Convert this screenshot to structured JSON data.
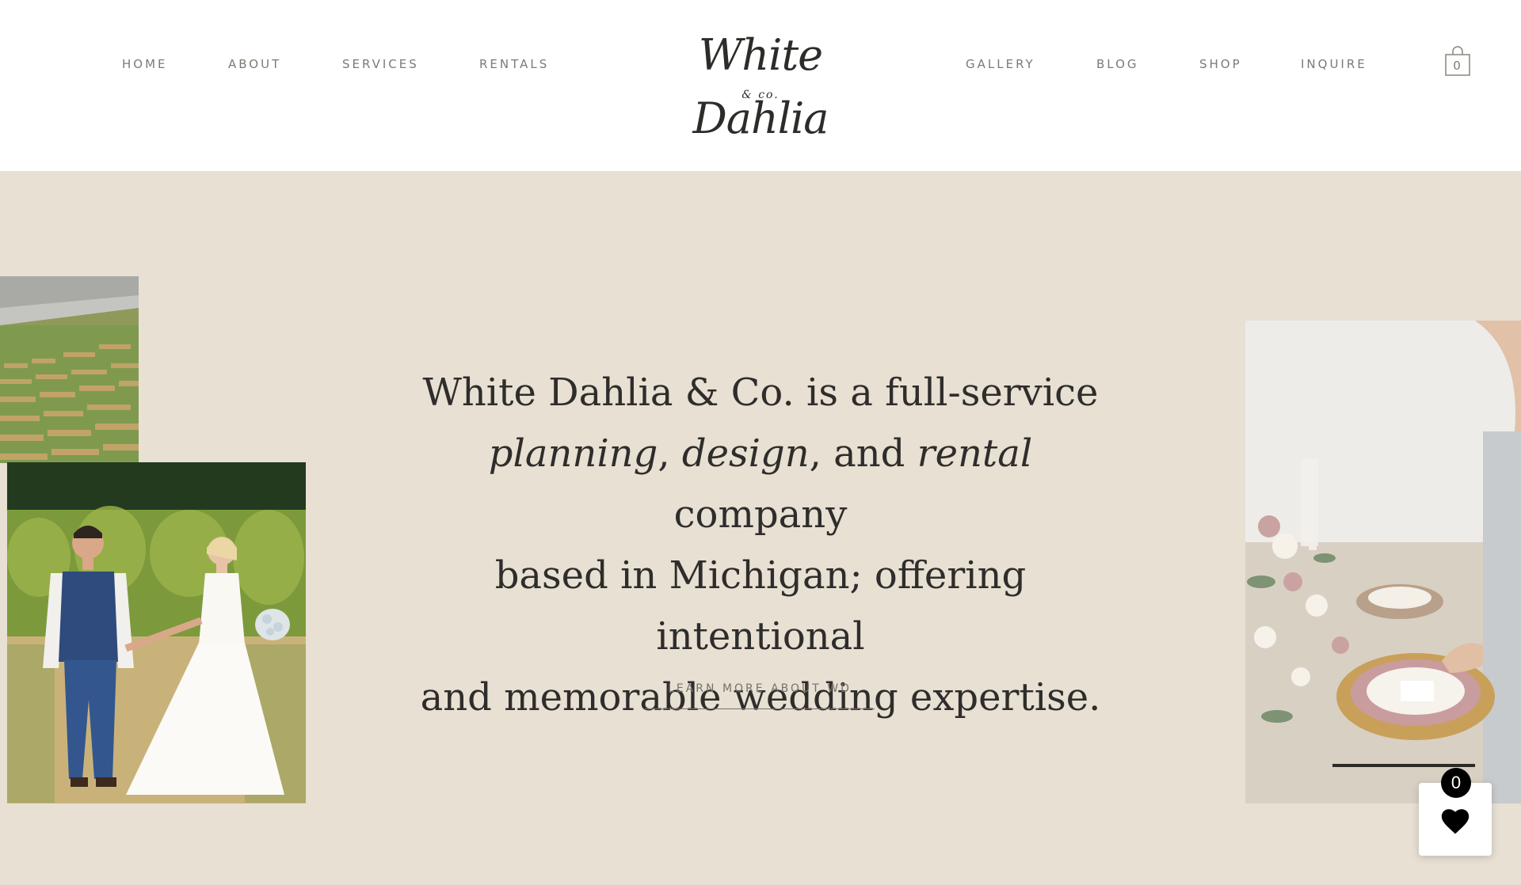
{
  "nav": {
    "left": [
      "HOME",
      "ABOUT",
      "SERVICES",
      "RENTALS"
    ],
    "right": [
      "GALLERY",
      "BLOG",
      "SHOP",
      "INQUIRE"
    ]
  },
  "logo": {
    "main": "White Dahlia",
    "sub": "& co."
  },
  "cart": {
    "count": "0"
  },
  "hero": {
    "line1": "White Dahlia & Co. is a full-service",
    "w_planning": "planning",
    "comma1": ",",
    "w_design": "design",
    "and_text": ", and",
    "w_rental": "rental",
    "company": "company",
    "line3": "based in Michigan; offering intentional",
    "line4": "and memorable wedding expertise."
  },
  "cta": {
    "label": "LEARN MORE ABOUT WD"
  },
  "wishlist": {
    "count": "0"
  },
  "colors": {
    "background": "#e7e0d3",
    "header": "#ffffff",
    "text": "#2f2d2b",
    "nav": "#7d7a72"
  }
}
